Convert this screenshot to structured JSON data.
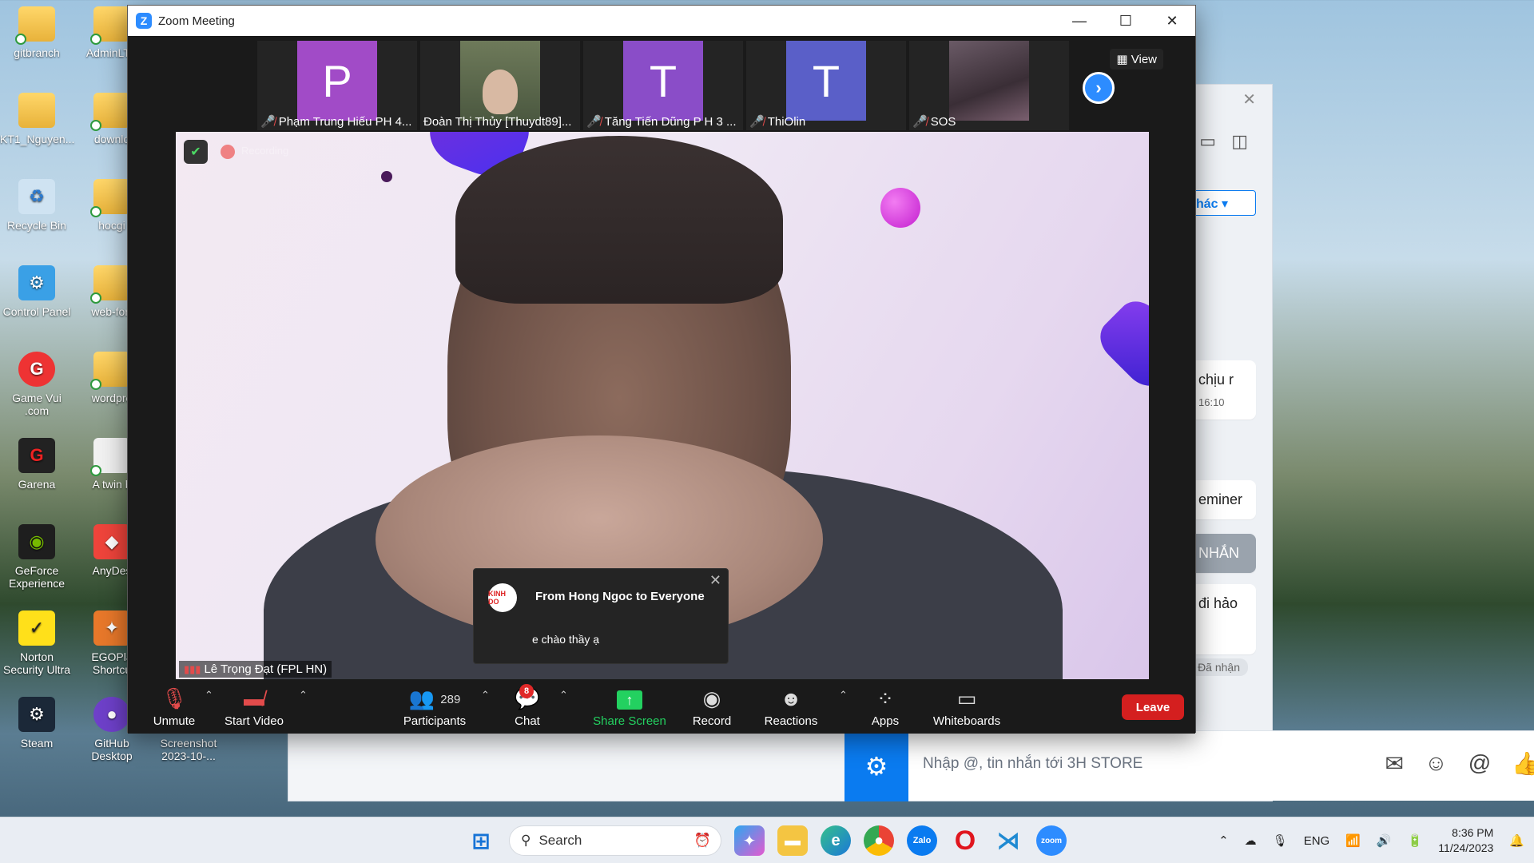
{
  "desktop": {
    "icons": [
      {
        "label": "gitbranch"
      },
      {
        "label": "AdminLTE"
      },
      {
        "label": "KT1_Nguyen..."
      },
      {
        "label": "downlo"
      },
      {
        "label": "Recycle Bin"
      },
      {
        "label": "hocgi"
      },
      {
        "label": "Control Panel"
      },
      {
        "label": "web-for-"
      },
      {
        "label": "Game Vui .com"
      },
      {
        "label": "wordpre"
      },
      {
        "label": "Garena"
      },
      {
        "label": "A twin b"
      },
      {
        "label": "GeForce Experience"
      },
      {
        "label": "AnyDes"
      },
      {
        "label": "Norton Security Ultra"
      },
      {
        "label": "EGOPla Shortcu"
      },
      {
        "label": "Steam"
      },
      {
        "label": "GitHub Desktop"
      },
      {
        "label": "Screenshot 2023-10-..."
      }
    ]
  },
  "zalo": {
    "filter_label": "hác",
    "messages": [
      {
        "text": "chịu r",
        "time": "16:10"
      },
      {
        "text": "eminer"
      },
      {
        "text": "NHẮN"
      },
      {
        "text": "đi hảo"
      }
    ],
    "received_label": "Đã nhận",
    "input_placeholder": "Nhập @, tin nhắn tới 3H STORE"
  },
  "zoom": {
    "title": "Zoom Meeting",
    "view_label": "View",
    "participants": [
      {
        "name": "Phạm Trung Hiếu PH 4...",
        "initial": "P",
        "color": "#a14bc7"
      },
      {
        "name": "Đoàn Thị Thủy [Thuydt89]...",
        "initial": "",
        "color": "#5d6b4a"
      },
      {
        "name": "Tăng Tiến Dũng P H 3 ...",
        "initial": "T",
        "color": "#8a4dc8"
      },
      {
        "name": "ThiOlin",
        "initial": "T",
        "color": "#5a5fc8"
      },
      {
        "name": "SOS",
        "initial": "",
        "color": "#4a3e48"
      }
    ],
    "recording_label": "Recording",
    "active_speaker": "Lê Trọng Đạt (FPL HN)",
    "notification": {
      "title": "From Hong Ngoc to Everyone",
      "message": "e chào thầy ạ",
      "avatar_text": "KINH DO"
    },
    "controls": {
      "unmute": "Unmute",
      "start_video": "Start Video",
      "participants": "Participants",
      "participants_count": "289",
      "chat": "Chat",
      "chat_badge": "8",
      "share_screen": "Share Screen",
      "record": "Record",
      "reactions": "Reactions",
      "apps": "Apps",
      "whiteboards": "Whiteboards",
      "leave": "Leave"
    }
  },
  "taskbar": {
    "search_label": "Search",
    "language": "ENG",
    "time": "8:36 PM",
    "date": "11/24/2023"
  }
}
